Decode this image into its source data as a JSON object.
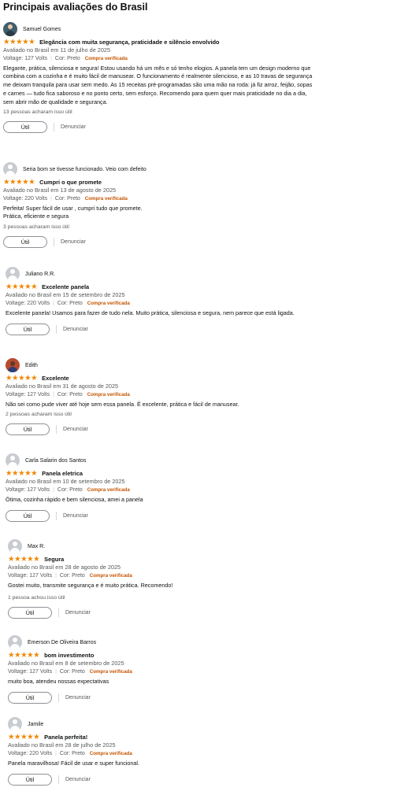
{
  "page_title": "Principais avaliações do Brasil",
  "labels": {
    "useful": "Útil",
    "report": "Denunciar",
    "voltage_prefix": "Voltage:",
    "color_prefix": "Cor:",
    "verified": "Compra verificada"
  },
  "colors": {
    "star": "#f08804",
    "verified": "#c45500",
    "muted": "#565959"
  },
  "reviews": [
    {
      "author": "Samuel Gomes",
      "avatar": "photo",
      "stars": 5,
      "title": "Elegância com muita segurança, praticidade e silêncio envolvido",
      "date": "Avaliado no Brasil em 11 de julho de 2025",
      "voltage": "127 Volts",
      "color": "Preto",
      "text": "Elegante, prática, silenciosa e segura! Estou usando há um mês e só tenho elogios. A panela tem um design moderno que combina com a cozinha e é muito fácil de manusear. O funcionamento é realmente silencioso, e as 10 travas de segurança me deixam tranquila para usar sem medo. As 15 receitas pré-programadas são uma mão na roda: já fiz arroz, feijão, sopas e carnes — tudo fica saboroso e no ponto certo, sem esforço. Recomendo para quem quer mais praticidade no dia a dia, sem abrir mão de qualidade e segurança.",
      "helpful": "13 pessoas acharam isso útil"
    },
    {
      "author": "Seria bom se tivesse funcionado. Veio com defeito",
      "avatar": "default",
      "stars": 5,
      "title": "Cumpri o que promete",
      "date": "Avaliado no Brasil em 13 de agosto de 2025",
      "voltage": "220 Volts",
      "color": "Preto",
      "text": "Perfeita! Super fácil de usar , cumpri tudo que promete.\nPrática, eficiente e segura",
      "helpful": "3 pessoas acharam isso útil"
    },
    {
      "author": "Juliano R.R.",
      "avatar": "default",
      "stars": 5,
      "title": "Excelente panela",
      "date": "Avaliado no Brasil em 15 de setembro de 2025",
      "voltage": "220 Volts",
      "color": "Preto",
      "text": "Excelente panela! Usamos para fazer de tudo nela. Muito prática, silenciosa e segura, nem parece que está ligada.",
      "helpful": ""
    },
    {
      "author": "Edith",
      "avatar": "photo",
      "stars": 5,
      "title": "Excelente",
      "date": "Avaliado no Brasil em 31 de agosto de 2025",
      "voltage": "127 Volts",
      "color": "Preto",
      "text": "Não sei como pude viver até hoje sem essa panela. É excelente, prática e fácil de manusear.",
      "helpful": "2 pessoas acharam isso útil"
    },
    {
      "author": "Carla Salarin dos Santos",
      "avatar": "default",
      "stars": 5,
      "title": "Panela eletrica",
      "date": "Avaliado no Brasil em 10 de setembro de 2025",
      "voltage": "127 Volts",
      "color": "Preto",
      "text": "Ótima, cozinha rápido e bem silenciosa, amei a panela",
      "helpful": ""
    },
    {
      "author": "Max R.",
      "avatar": "default",
      "stars": 5,
      "title": "Segura",
      "date": "Avaliado no Brasil em 28 de agosto de 2025",
      "voltage": "127 Volts",
      "color": "Preto",
      "text": "Gostei muito, transmite segurança e é muito prática. Recomendo!",
      "helpful": "1 pessoa achou isso útil"
    },
    {
      "author": "Emerson De Oliveira Barros",
      "avatar": "default",
      "stars": 5,
      "title": "bom investimento",
      "date": "Avaliado no Brasil em 8 de setembro de 2025",
      "voltage": "127 Volts",
      "color": "Preto",
      "text": "muito boa, atendeu nossas expectativas",
      "helpful": ""
    },
    {
      "author": "Jamile",
      "avatar": "default",
      "stars": 5,
      "title": "Panela perfeita!",
      "date": "Avaliado no Brasil em 28 de julho de 2025",
      "voltage": "220 Volts",
      "color": "Preto",
      "text": "Panela maravilhosa! Fácil de usar e super funcional.",
      "helpful": ""
    }
  ]
}
